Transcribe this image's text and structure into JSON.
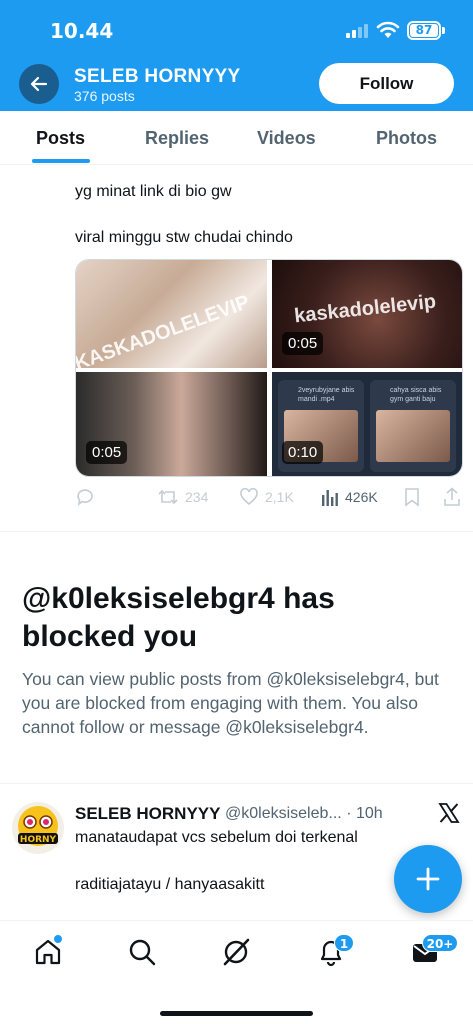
{
  "status_bar": {
    "time": "10.44",
    "battery": "87"
  },
  "header": {
    "name": "SELEB HORNYYY",
    "posts": "376 posts",
    "follow_label": "Follow"
  },
  "tabs": [
    "Posts",
    "Replies",
    "Videos",
    "Photos"
  ],
  "tweet1": {
    "line1": "yg minat link di bio gw",
    "line2": "viral minggu stw chudai chindo",
    "media": [
      {
        "watermark": "KASKADOLELEVIP"
      },
      {
        "watermark": "kaskadolelevip",
        "duration": "0:05"
      },
      {
        "duration": "0:05"
      },
      {
        "duration": "0:10",
        "cards": [
          "2veyrubyjane abis mandi .mp4",
          "cahya sisca abis gym ganti baju"
        ]
      }
    ],
    "actions": {
      "retweets": "234",
      "likes": "2,1K",
      "views": "426K"
    }
  },
  "blocked": {
    "title": "@k0leksiselebgr4 has blocked you",
    "body": "You can view public posts from @k0leksiselebgr4, but you are blocked from engaging with them. You also cannot follow or message @k0leksiselebgr4."
  },
  "tweet2": {
    "name": "SELEB HORNYYY",
    "handle": "@k0leksiseleb...",
    "sep": "·",
    "time": "10h",
    "line1": "manataudapat vcs sebelum doi terkenal",
    "line2": "raditiajatayu / hanyaasakitt",
    "avatar_text": "HORNY"
  },
  "nav": {
    "notifications_badge": "1",
    "messages_badge": "20+"
  },
  "colors": {
    "brand": "#1d9bf0",
    "text": "#0f1419",
    "muted": "#536471"
  }
}
